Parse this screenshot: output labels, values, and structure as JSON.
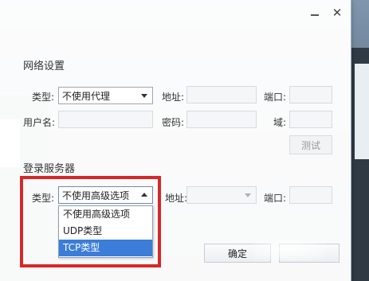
{
  "titlebar": {
    "minimize_icon": "minimize-icon",
    "close_glyph": "✕"
  },
  "network": {
    "title": "网络设置",
    "type_label": "类型:",
    "type_value": "不使用代理",
    "address_label": "地址:",
    "port_label": "端口:",
    "username_label": "用户名:",
    "password_label": "密码:",
    "domain_label": "域:",
    "test_button": "测试"
  },
  "login_server": {
    "title": "登录服务器",
    "type_label": "类型:",
    "type_value": "不使用高级选项",
    "address_label": "地址:",
    "port_label": "端口:"
  },
  "dropdown": {
    "options": [
      "不使用高级选项",
      "UDP类型",
      "TCP类型"
    ],
    "selected_index": 2
  },
  "footer": {
    "ok_button": "确定"
  },
  "colors": {
    "highlight": "#d62828",
    "selection": "#3b7dd8"
  }
}
